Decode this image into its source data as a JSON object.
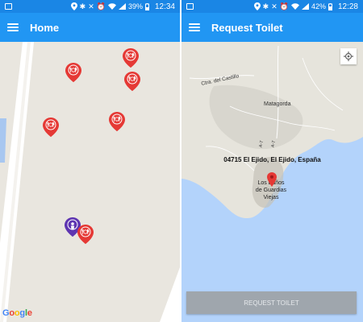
{
  "left_screen": {
    "status_bar": {
      "battery": "39%",
      "time": "12:34"
    },
    "app_bar": {
      "title": "Home"
    },
    "map": {
      "attribution": "Google"
    },
    "markers": [
      {
        "type": "restaurant-marker",
        "color": "#e53935"
      },
      {
        "type": "restaurant-marker",
        "color": "#e53935"
      },
      {
        "type": "restaurant-marker",
        "color": "#e53935"
      },
      {
        "type": "restaurant-marker",
        "color": "#e53935"
      },
      {
        "type": "restaurant-marker",
        "color": "#e53935"
      },
      {
        "type": "person-marker",
        "color": "#5e35b1"
      },
      {
        "type": "restaurant-marker",
        "color": "#e53935"
      }
    ]
  },
  "right_screen": {
    "status_bar": {
      "battery": "42%",
      "time": "12:28"
    },
    "app_bar": {
      "title": "Request Toilet"
    },
    "map": {
      "labels": {
        "road": "Ctra. del Castillo",
        "place": "Matagorda",
        "road2": "A-7",
        "road3": "A-7"
      },
      "address": "04715 El Ejido, El Ejido, España",
      "town_lines": [
        "Los Baños",
        "de Guardias",
        "Viejas"
      ]
    },
    "request_button": "REQUEST TOILET"
  },
  "colors": {
    "status_bar": "#1a86e5",
    "app_bar": "#2196f3",
    "sea": "#b3d3fb",
    "land": "#e9e6df",
    "marker_red": "#e53935"
  }
}
